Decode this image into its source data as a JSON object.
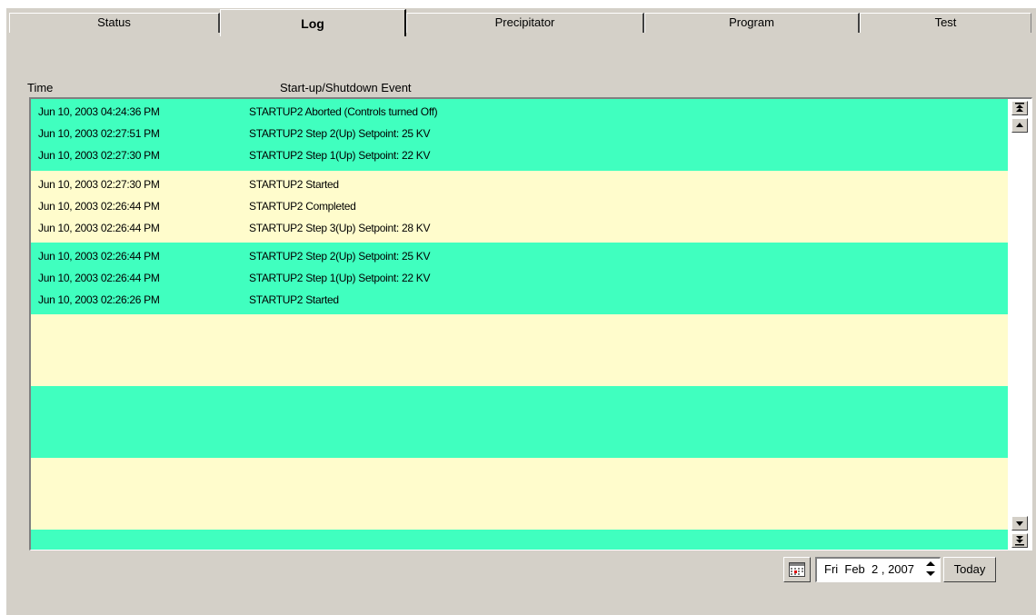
{
  "tabs": {
    "status": "Status",
    "log": "Log",
    "precipitator": "Precipitator",
    "program": "Program",
    "test": "Test",
    "active": "Log"
  },
  "columns": {
    "time": "Time",
    "event": "Start-up/Shutdown Event"
  },
  "log": {
    "band_colors": [
      "#40ffbf",
      "#fffccc"
    ],
    "rows": [
      {
        "time": "Jun 10, 2003 04:24:36 PM",
        "event": "STARTUP2 Aborted (Controls turned Off)"
      },
      {
        "time": "Jun 10, 2003 02:27:51 PM",
        "event": "STARTUP2 Step 2(Up) Setpoint: 25 KV"
      },
      {
        "time": "Jun 10, 2003 02:27:30 PM",
        "event": "STARTUP2 Step 1(Up) Setpoint: 22 KV"
      },
      {
        "time": "Jun 10, 2003 02:27:30 PM",
        "event": "STARTUP2 Started"
      },
      {
        "time": "Jun 10, 2003 02:26:44 PM",
        "event": "STARTUP2 Completed"
      },
      {
        "time": "Jun 10, 2003 02:26:44 PM",
        "event": "STARTUP2 Step 3(Up) Setpoint: 28 KV"
      },
      {
        "time": "Jun 10, 2003 02:26:44 PM",
        "event": "STARTUP2 Step 2(Up) Setpoint: 25 KV"
      },
      {
        "time": "Jun 10, 2003 02:26:44 PM",
        "event": "STARTUP2 Step 1(Up) Setpoint: 22 KV"
      },
      {
        "time": "Jun 10, 2003 02:26:26 PM",
        "event": "STARTUP2 Started"
      }
    ]
  },
  "date_picker": {
    "value": "Fri  Feb  2 , 2007",
    "today_label": "Today"
  },
  "icons": {
    "scroll_top": "double-up-arrow-icon",
    "scroll_up": "up-arrow-icon",
    "scroll_down": "down-arrow-icon",
    "scroll_bottom": "double-down-arrow-icon",
    "calendar": "calendar-icon"
  }
}
